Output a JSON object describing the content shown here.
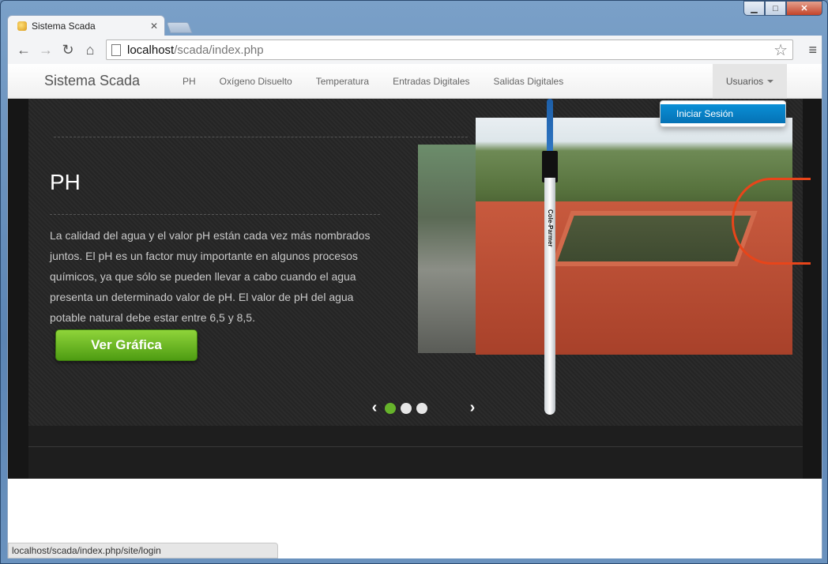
{
  "browser": {
    "tab_title": "Sistema Scada",
    "url_host": "localhost",
    "url_path": "/scada/index.php",
    "status_url": "localhost/scada/index.php/site/login"
  },
  "navbar": {
    "brand": "Sistema Scada",
    "links": [
      "PH",
      "Oxígeno Disuelto",
      "Temperatura",
      "Entradas Digitales",
      "Salidas Digitales"
    ],
    "users_label": "Usuarios",
    "dropdown_item": "Iniciar Sesión"
  },
  "slide": {
    "title": "PH",
    "text": "La calidad del agua y el valor pH están cada vez más nombrados juntos. El pH es un factor muy importante en algunos procesos químicos, ya que sólo se pueden llevar a cabo cuando el agua presenta un determinado valor de pH. El valor de pH del agua potable natural debe estar entre 6,5 y 8,5.",
    "button": "Ver Gráfica",
    "probe_label": "Cole-Parmer",
    "active_dot": 1,
    "dot_count": 3
  },
  "colors": {
    "accent_green": "#66b32b",
    "dropdown_blue": "#0a8fd6"
  }
}
